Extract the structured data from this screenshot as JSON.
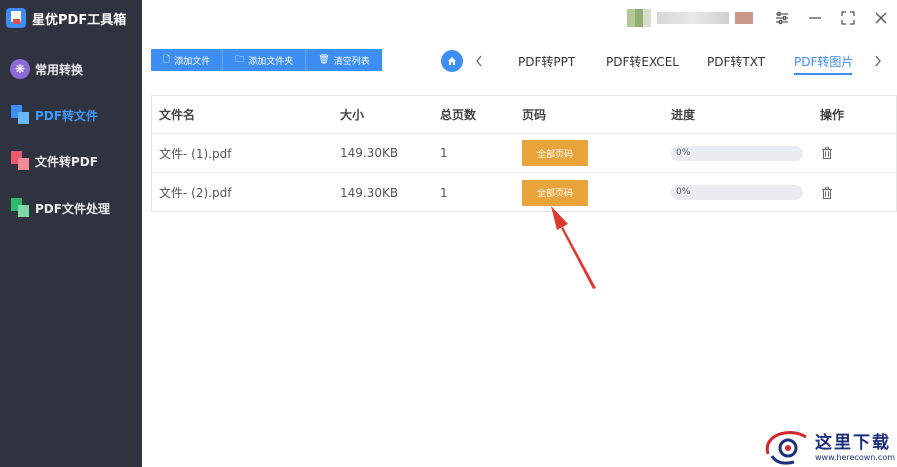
{
  "app": {
    "title": "星优PDF工具箱"
  },
  "sidebar": {
    "items": [
      {
        "label": "常用转换",
        "icon": "common-icon"
      },
      {
        "label": "PDF转文件",
        "icon": "pdf-to-file-icon",
        "active": true
      },
      {
        "label": "文件转PDF",
        "icon": "file-to-pdf-icon"
      },
      {
        "label": "PDF文件处理",
        "icon": "pdf-process-icon"
      }
    ]
  },
  "window_controls": [
    "settings-icon",
    "minimize-icon",
    "maximize-icon",
    "close-icon"
  ],
  "toolbar": {
    "add_file": "添加文件",
    "add_folder": "添加文件夹",
    "clear_list": "清空列表"
  },
  "tabs": {
    "items": [
      "PDF转PPT",
      "PDF转EXCEL",
      "PDF转TXT",
      "PDF转图片"
    ],
    "active": "PDF转图片"
  },
  "table": {
    "headers": {
      "name": "文件名",
      "size": "大小",
      "pages": "总页数",
      "page_range": "页码",
      "progress": "进度",
      "action": "操作"
    },
    "rows": [
      {
        "name": "文件- (1).pdf",
        "size": "149.30KB",
        "pages": "1",
        "page_button": "全部页码",
        "progress_text": "0%",
        "progress_value": 0
      },
      {
        "name": "文件- (2).pdf",
        "size": "149.30KB",
        "pages": "1",
        "page_button": "全部页码",
        "progress_text": "0%",
        "progress_value": 0
      }
    ]
  },
  "watermark": {
    "text": "这里下载",
    "url": "www.herecown.com"
  },
  "colors": {
    "sidebar_bg": "#2f3340",
    "accent": "#3d8ef5",
    "page_button": "#e8a43b",
    "annotation_arrow": "#e03a2f"
  }
}
